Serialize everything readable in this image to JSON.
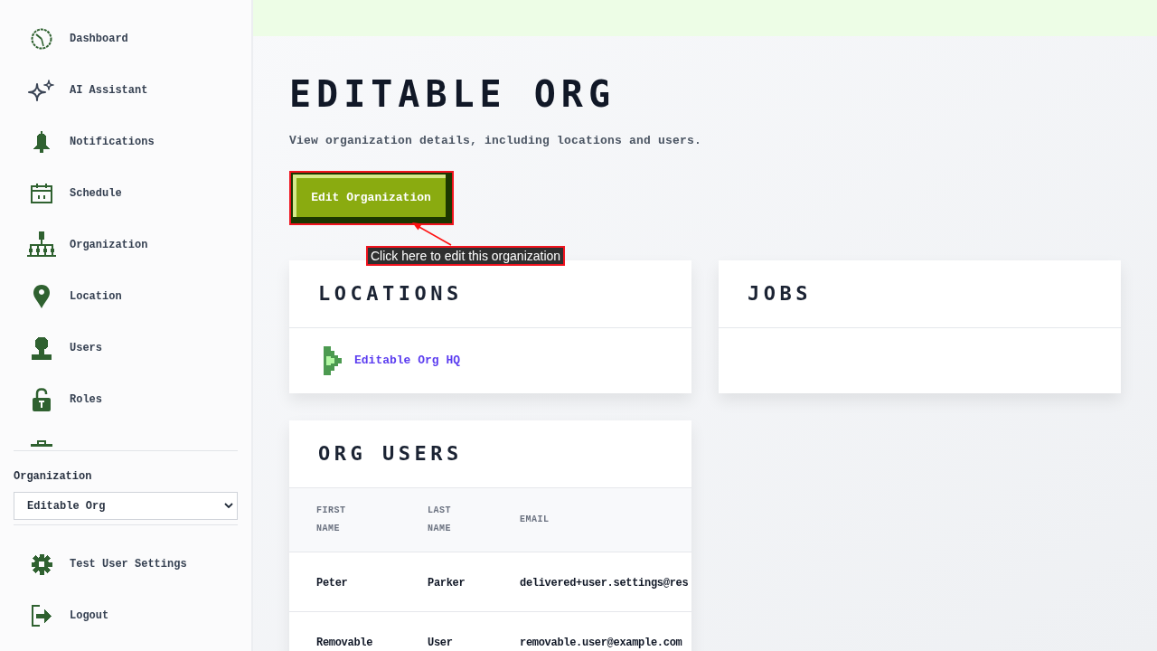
{
  "sidebar": {
    "nav_items": [
      {
        "label": "Dashboard"
      },
      {
        "label": "AI Assistant"
      },
      {
        "label": "Notifications"
      },
      {
        "label": "Schedule"
      },
      {
        "label": "Organization"
      },
      {
        "label": "Location"
      },
      {
        "label": "Users"
      },
      {
        "label": "Roles"
      }
    ],
    "organization_picker": {
      "label": "Organization",
      "value": "Editable Org"
    },
    "footer_items": [
      {
        "label": "Test User Settings"
      },
      {
        "label": "Logout"
      }
    ]
  },
  "header": {
    "title": "EDITABLE ORG",
    "subtitle": "View organization details, including locations and users.",
    "edit_button": {
      "label": "Edit Organization"
    },
    "annotation": {
      "text": "Click here to edit this organization"
    }
  },
  "locations_card": {
    "title": "LOCATIONS",
    "items": [
      {
        "name": "Editable Org HQ"
      }
    ]
  },
  "jobs_card": {
    "title": "JOBS"
  },
  "users_card": {
    "title": "ORG USERS",
    "table": {
      "columns": [
        "FIRST NAME",
        "LAST NAME",
        "EMAIL"
      ],
      "rows": [
        [
          "Peter",
          "Parker",
          "delivered+user.settings@res"
        ],
        [
          "Removable",
          "User",
          "removable.user@example.com"
        ]
      ]
    }
  }
}
